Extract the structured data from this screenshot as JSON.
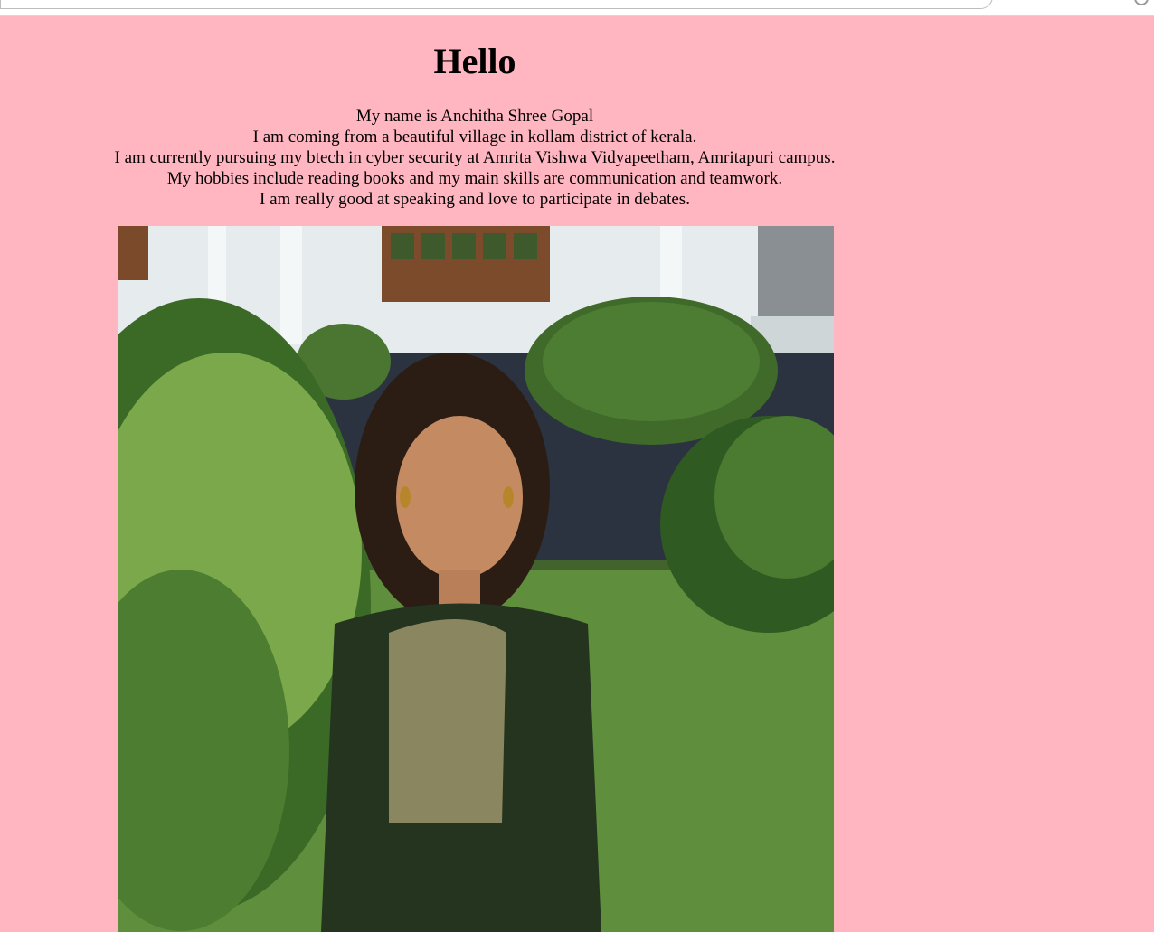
{
  "page": {
    "heading": "Hello",
    "bio_lines": [
      "My name is Anchitha Shree Gopal",
      "I am coming from a beautiful village in kollam district of kerala.",
      "I am currently pursuing my btech in cyber security at Amrita Vishwa Vidyapeetham, Amritapuri campus.",
      "My hobbies include reading books and my main skills are communication and teamwork.",
      "I am really good at speaking and love to participate in debates."
    ]
  },
  "colors": {
    "background": "#ffb6c1"
  }
}
